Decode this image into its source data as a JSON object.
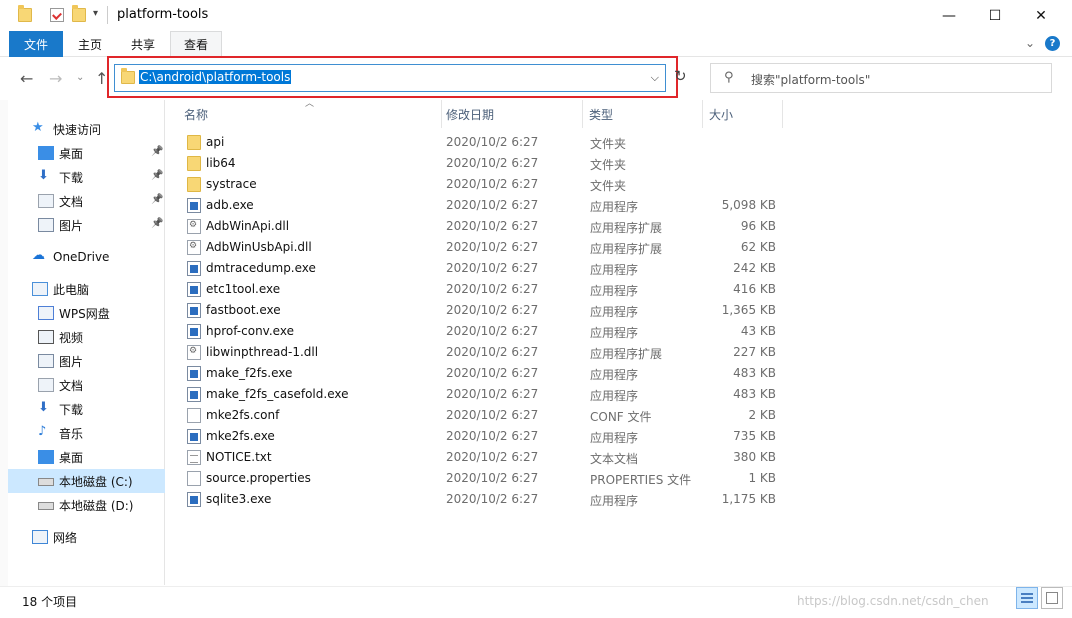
{
  "window": {
    "title": "platform-tools",
    "minimize": "—",
    "maximize": "☐",
    "close": "✕"
  },
  "ribbon": {
    "tabs": [
      "文件",
      "主页",
      "共享",
      "查看"
    ],
    "collapse": "⌄",
    "help": "?"
  },
  "nav": {
    "back": "←",
    "forward": "→",
    "recent": "⌄",
    "up": "↑",
    "address": "C:\\android\\platform-tools",
    "refresh": "↻",
    "search_placeholder": "搜索\"platform-tools\""
  },
  "sidebar": {
    "items": [
      {
        "label": "快速访问",
        "icon": "star-icon",
        "pinned": false
      },
      {
        "label": "桌面",
        "icon": "desktop-icon",
        "pinned": true
      },
      {
        "label": "下载",
        "icon": "download-icon",
        "pinned": true
      },
      {
        "label": "文档",
        "icon": "document-icon",
        "pinned": true
      },
      {
        "label": "图片",
        "icon": "picture-icon",
        "pinned": true
      },
      {
        "label": "OneDrive",
        "icon": "cloud-icon",
        "pinned": false
      },
      {
        "label": "此电脑",
        "icon": "computer-icon",
        "pinned": false
      },
      {
        "label": "WPS网盘",
        "icon": "wps-cloud-icon",
        "pinned": false
      },
      {
        "label": "视频",
        "icon": "video-icon",
        "pinned": false
      },
      {
        "label": "图片",
        "icon": "picture-icon",
        "pinned": false
      },
      {
        "label": "文档",
        "icon": "document-icon",
        "pinned": false
      },
      {
        "label": "下载",
        "icon": "download-icon",
        "pinned": false
      },
      {
        "label": "音乐",
        "icon": "music-icon",
        "pinned": false
      },
      {
        "label": "桌面",
        "icon": "desktop-icon",
        "pinned": false
      },
      {
        "label": "本地磁盘 (C:)",
        "icon": "drive-icon",
        "pinned": false,
        "selected": true
      },
      {
        "label": "本地磁盘 (D:)",
        "icon": "drive-icon",
        "pinned": false
      },
      {
        "label": "网络",
        "icon": "network-icon",
        "pinned": false
      }
    ]
  },
  "columns": {
    "name": "名称",
    "date": "修改日期",
    "type": "类型",
    "size": "大小"
  },
  "files": [
    {
      "name": "api",
      "date": "2020/10/2 6:27",
      "type": "文件夹",
      "size": "",
      "kind": "folder"
    },
    {
      "name": "lib64",
      "date": "2020/10/2 6:27",
      "type": "文件夹",
      "size": "",
      "kind": "folder"
    },
    {
      "name": "systrace",
      "date": "2020/10/2 6:27",
      "type": "文件夹",
      "size": "",
      "kind": "folder"
    },
    {
      "name": "adb.exe",
      "date": "2020/10/2 6:27",
      "type": "应用程序",
      "size": "5,098 KB",
      "kind": "exe"
    },
    {
      "name": "AdbWinApi.dll",
      "date": "2020/10/2 6:27",
      "type": "应用程序扩展",
      "size": "96 KB",
      "kind": "dll"
    },
    {
      "name": "AdbWinUsbApi.dll",
      "date": "2020/10/2 6:27",
      "type": "应用程序扩展",
      "size": "62 KB",
      "kind": "dll"
    },
    {
      "name": "dmtracedump.exe",
      "date": "2020/10/2 6:27",
      "type": "应用程序",
      "size": "242 KB",
      "kind": "exe"
    },
    {
      "name": "etc1tool.exe",
      "date": "2020/10/2 6:27",
      "type": "应用程序",
      "size": "416 KB",
      "kind": "exe"
    },
    {
      "name": "fastboot.exe",
      "date": "2020/10/2 6:27",
      "type": "应用程序",
      "size": "1,365 KB",
      "kind": "exe"
    },
    {
      "name": "hprof-conv.exe",
      "date": "2020/10/2 6:27",
      "type": "应用程序",
      "size": "43 KB",
      "kind": "exe"
    },
    {
      "name": "libwinpthread-1.dll",
      "date": "2020/10/2 6:27",
      "type": "应用程序扩展",
      "size": "227 KB",
      "kind": "dll"
    },
    {
      "name": "make_f2fs.exe",
      "date": "2020/10/2 6:27",
      "type": "应用程序",
      "size": "483 KB",
      "kind": "exe"
    },
    {
      "name": "make_f2fs_casefold.exe",
      "date": "2020/10/2 6:27",
      "type": "应用程序",
      "size": "483 KB",
      "kind": "exe"
    },
    {
      "name": "mke2fs.conf",
      "date": "2020/10/2 6:27",
      "type": "CONF 文件",
      "size": "2 KB",
      "kind": "doc"
    },
    {
      "name": "mke2fs.exe",
      "date": "2020/10/2 6:27",
      "type": "应用程序",
      "size": "735 KB",
      "kind": "exe"
    },
    {
      "name": "NOTICE.txt",
      "date": "2020/10/2 6:27",
      "type": "文本文档",
      "size": "380 KB",
      "kind": "txt"
    },
    {
      "name": "source.properties",
      "date": "2020/10/2 6:27",
      "type": "PROPERTIES 文件",
      "size": "1 KB",
      "kind": "doc"
    },
    {
      "name": "sqlite3.exe",
      "date": "2020/10/2 6:27",
      "type": "应用程序",
      "size": "1,175 KB",
      "kind": "exe"
    }
  ],
  "status": {
    "count": "18 个项目",
    "watermark": "https://blog.csdn.net/csdn_chen"
  }
}
